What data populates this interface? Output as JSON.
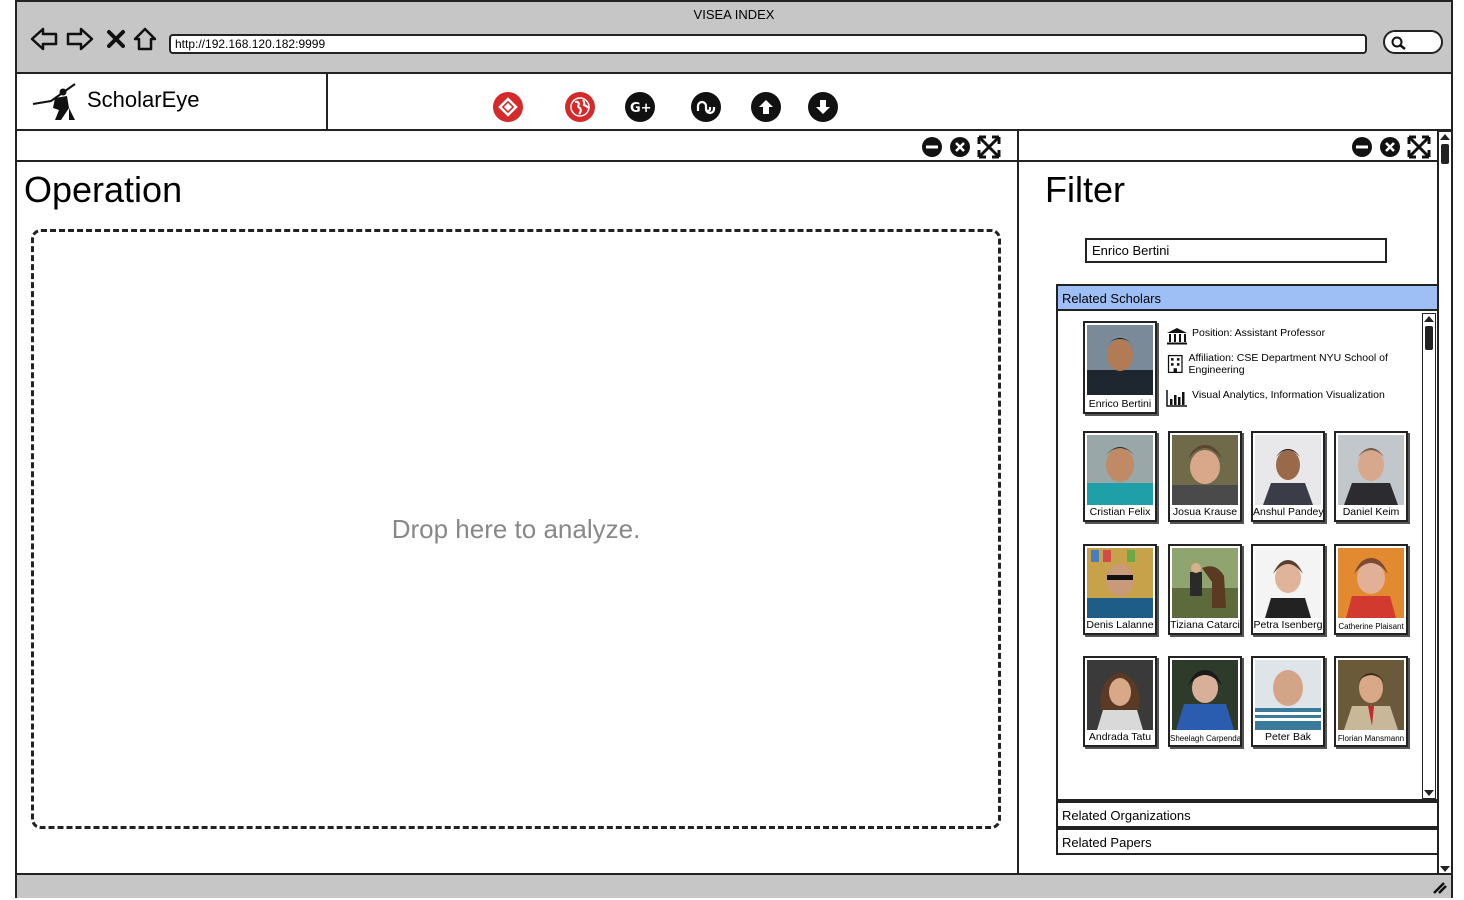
{
  "window": {
    "title": "VISEA INDEX",
    "url": "http://192.168.120.182:9999"
  },
  "app": {
    "name": "ScholarEye"
  },
  "toolbar": {
    "icons": [
      "gplus-swirl-icon",
      "globe-icon",
      "google-plus-icon",
      "stumbleupon-icon",
      "upload-arrow-icon",
      "download-arrow-icon"
    ],
    "colors": {
      "red": "#d42a2a",
      "dark": "#111111"
    }
  },
  "operation": {
    "title": "Operation",
    "drop_text": "Drop here to analyze."
  },
  "filter": {
    "title": "Filter",
    "search_value": "Enrico Bertini",
    "related_scholars_label": "Related Scholars",
    "related_organizations_label": "Related Organizations",
    "related_papers_label": "Related Papers",
    "accent": "#9dbff6"
  },
  "profile": {
    "name": "Enrico Bertini",
    "position": "Position: Assistant Professor",
    "affiliation": "Affiliation: CSE Department NYU School of Engineering",
    "interests": "Visual Analytics, Information Visualization"
  },
  "scholars": [
    {
      "name": "Cristian Felix"
    },
    {
      "name": "Josua Krause"
    },
    {
      "name": "Anshul Pandey"
    },
    {
      "name": "Daniel Keim"
    },
    {
      "name": "Denis Lalanne"
    },
    {
      "name": "Tiziana Catarci"
    },
    {
      "name": "Petra Isenberg"
    },
    {
      "name": "Catherine Plaisant"
    },
    {
      "name": "Andrada Tatu"
    },
    {
      "name": "Sheelagh Carpendale"
    },
    {
      "name": "Peter Bak"
    },
    {
      "name": "Florian Mansmann"
    }
  ]
}
